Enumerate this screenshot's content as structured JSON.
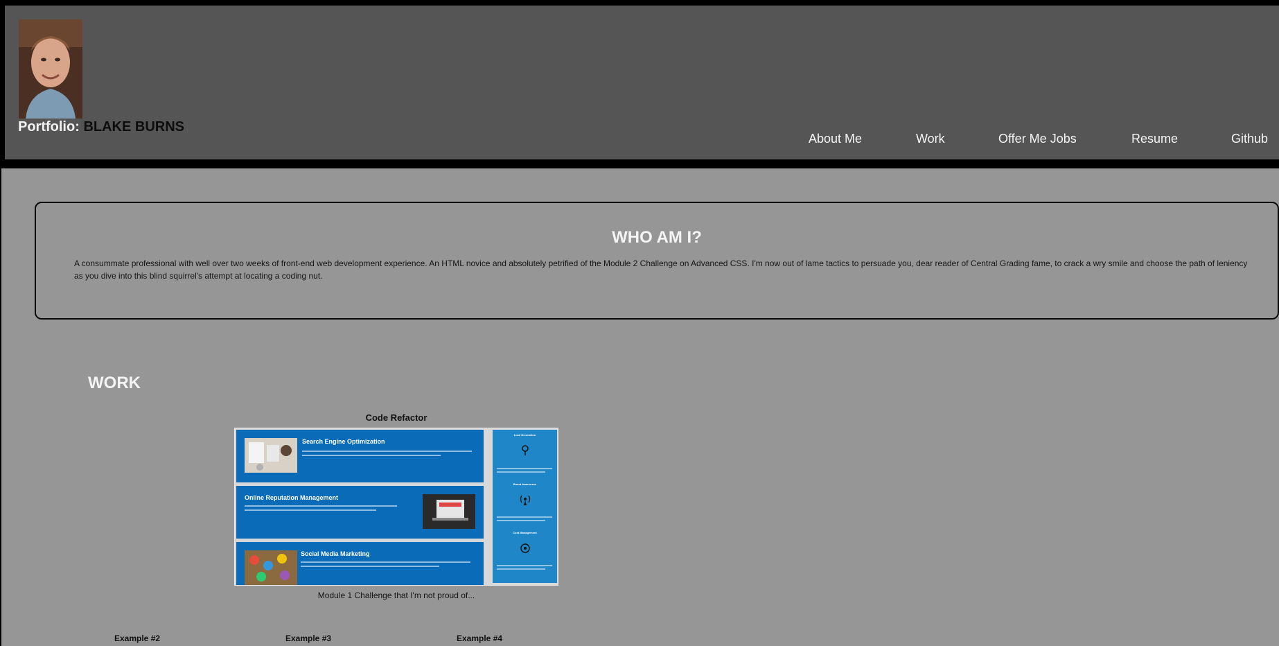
{
  "header": {
    "title_prefix": "Portfolio: ",
    "title_name": "BLAKE BURNS",
    "nav": [
      "About Me",
      "Work",
      "Offer Me Jobs",
      "Resume",
      "Github"
    ]
  },
  "about": {
    "heading": "WHO AM I?",
    "text": "A consummate professional with well over two weeks of front-end web development experience. An HTML novice and absolutely petrified of the Module 2 Challenge on Advanced CSS. I'm now out of lame tactics to persuade you, dear reader of Central Grading fame, to crack a wry smile and choose the path of leniency as you dive into this blind squirrel's attempt at locating a coding nut."
  },
  "work": {
    "heading": "WORK",
    "feature": {
      "title": "Code Refactor",
      "caption": "Module 1 Challenge that I'm not proud of...",
      "services": [
        {
          "title": "Search Engine Optimization"
        },
        {
          "title": "Online Reputation Management"
        },
        {
          "title": "Social Media Marketing"
        }
      ],
      "side": [
        "Lead Generation",
        "Brand Awareness",
        "Cost Management"
      ]
    },
    "examples": [
      "Example #2",
      "Example #3",
      "Example #4"
    ]
  },
  "colors": {
    "header_bg": "#555555",
    "main_bg": "#969696",
    "accent_blue": "#0a6bb8"
  }
}
